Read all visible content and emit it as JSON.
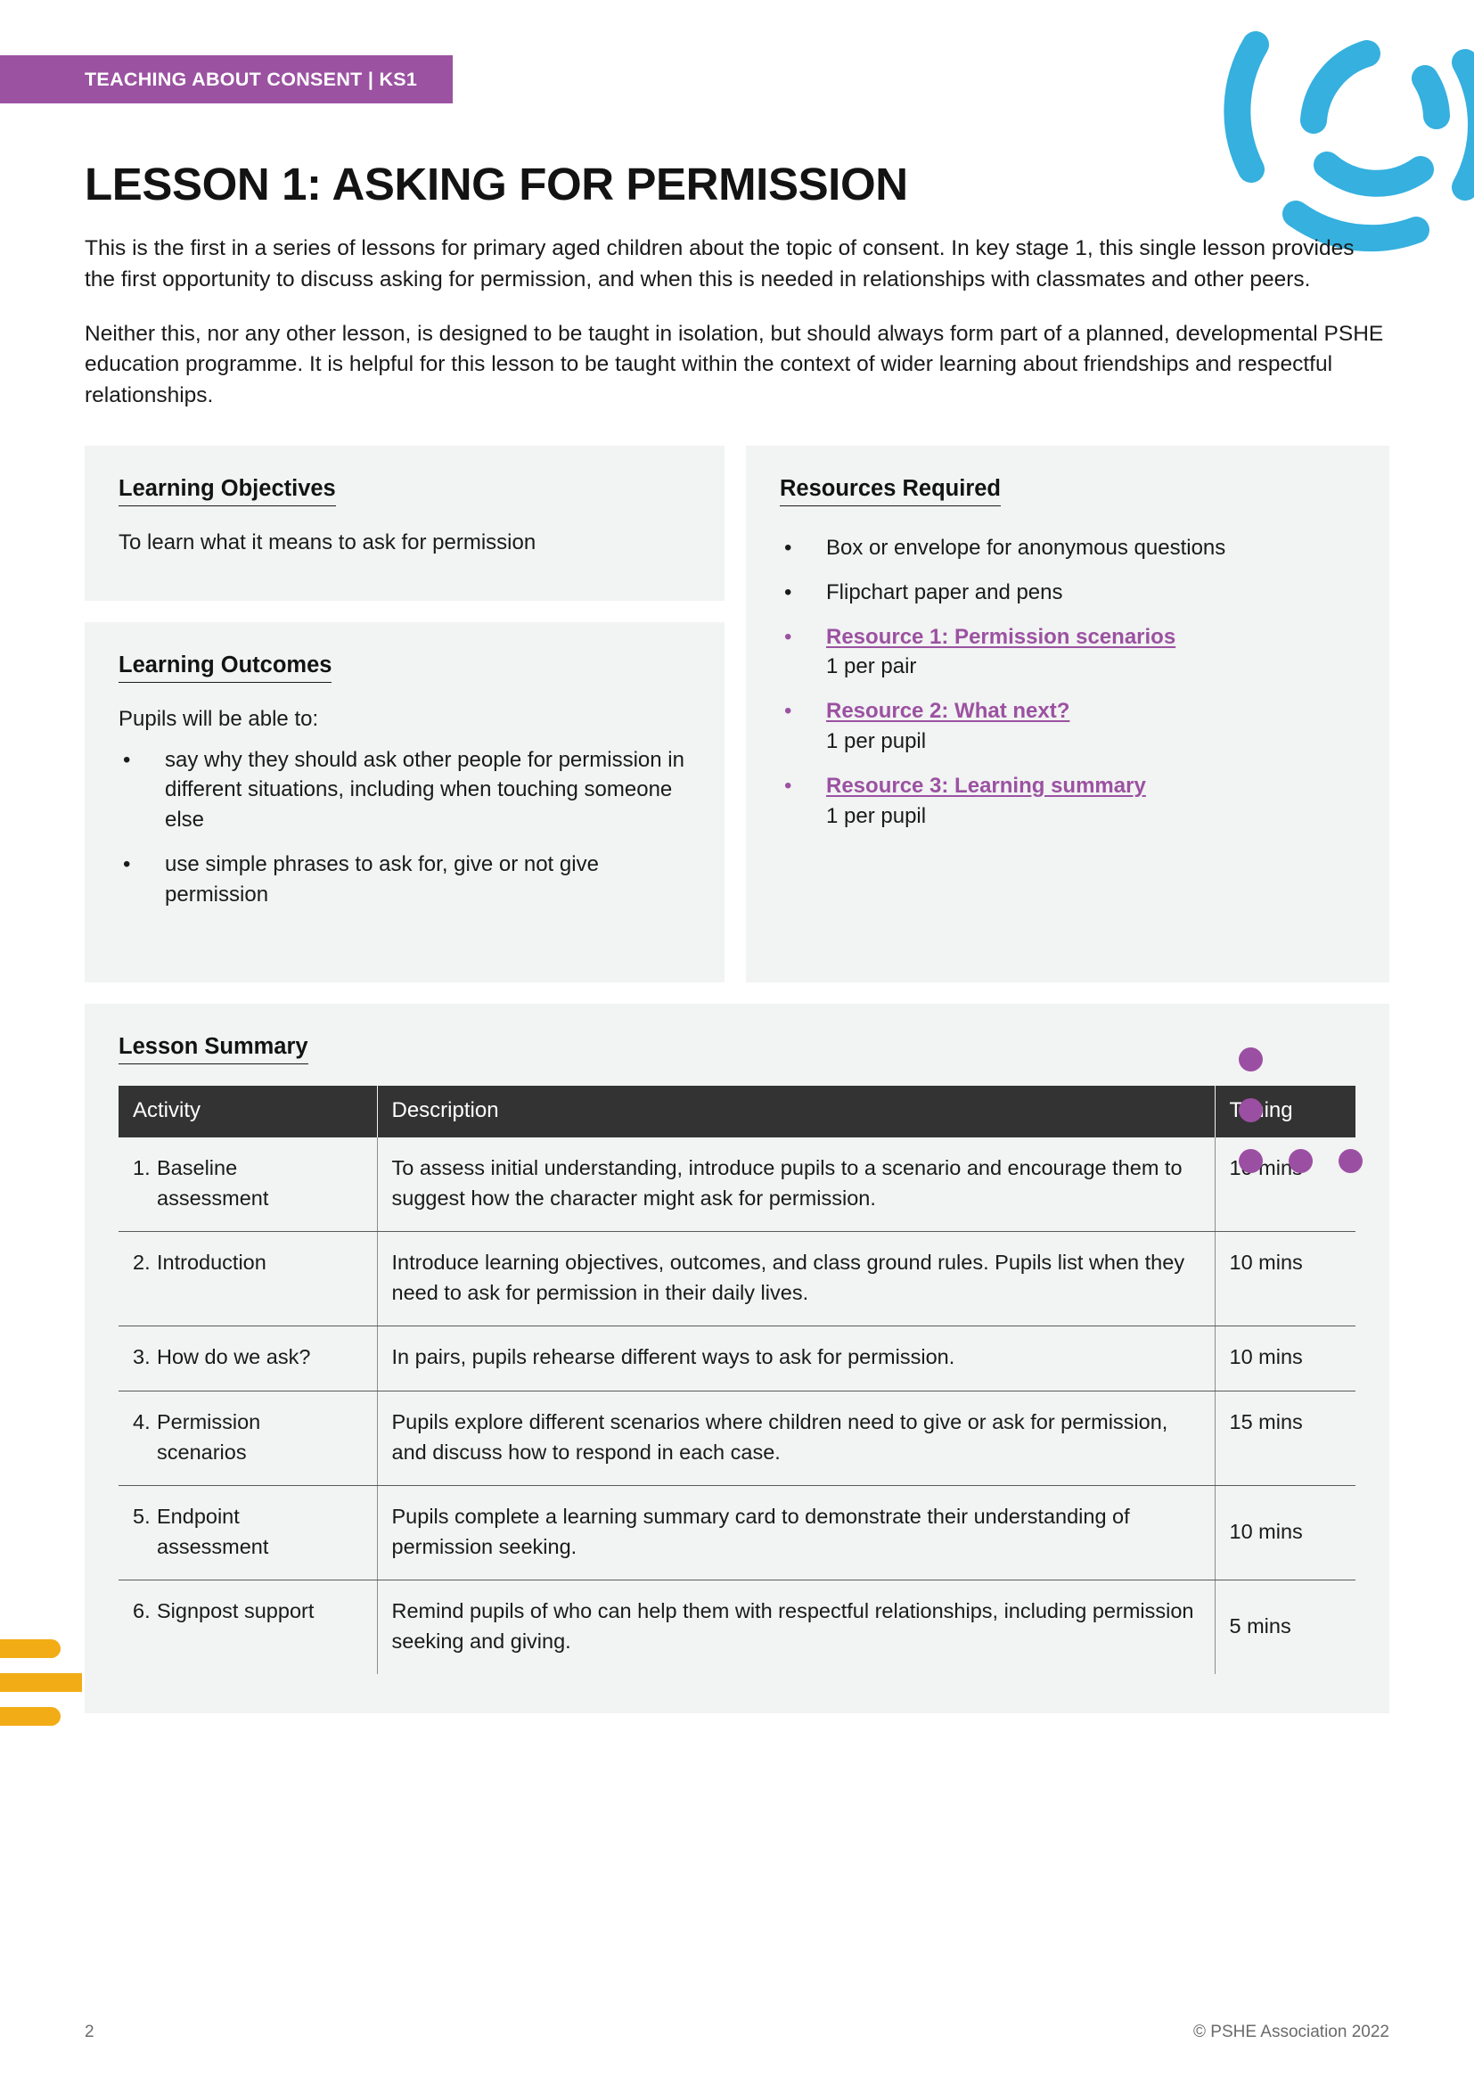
{
  "banner": {
    "label": "TEACHING ABOUT CONSENT | KS1",
    "bg_color": "#9B52A1"
  },
  "title": "LESSON 1: ASKING FOR PERMISSION",
  "intro": {
    "paragraph_1": "This is the first in a series of lessons for primary aged children about the topic of consent. In key stage 1, this single lesson provides the first opportunity to discuss asking for permission, and when this is needed in relationships with classmates and other peers.",
    "paragraph_2": "Neither this, nor any other lesson, is designed to be taught in isolation, but should always form part of a planned, developmental PSHE education programme. It is helpful for this lesson to be taught within the context of wider learning about friendships and respectful relationships."
  },
  "learning_objectives": {
    "heading": "Learning Objectives",
    "text": "To learn what it means to ask for permission"
  },
  "learning_outcomes": {
    "heading": "Learning Outcomes",
    "lead": "Pupils will be able to:",
    "bullets": [
      "say why they should ask other people for permission in different situations, including when touching someone else",
      "use simple phrases to ask for, give or not give permission"
    ]
  },
  "resources": {
    "heading": "Resources Required",
    "items": [
      {
        "text": "Box or envelope for anonymous questions",
        "link": false,
        "note": ""
      },
      {
        "text": "Flipchart paper and pens",
        "link": false,
        "note": ""
      },
      {
        "text": "Resource 1: Permission scenarios",
        "link": true,
        "note": "1 per pair"
      },
      {
        "text": "Resource 2: What next?",
        "link": true,
        "note": "1 per pupil"
      },
      {
        "text": "Resource 3: Learning summary ",
        "link": true,
        "note": "1 per pupil"
      }
    ],
    "link_color": "#9B52A1"
  },
  "lesson_summary": {
    "heading": "Lesson Summary",
    "columns": [
      "Activity",
      "Description",
      "Timing"
    ],
    "rows": [
      {
        "num": "1.",
        "activity": "Baseline assessment",
        "description": "To assess initial understanding, introduce pupils to a scenario and encourage them to suggest how the character might ask for permission.",
        "timing": "10 mins"
      },
      {
        "num": "2.",
        "activity": "Introduction",
        "description": "Introduce learning objectives, outcomes, and class ground rules. Pupils list when they need to ask for permission in their daily lives.",
        "timing": "10 mins"
      },
      {
        "num": "3.",
        "activity": "How do we ask?",
        "description": "In pairs, pupils rehearse different ways to ask for permission.",
        "timing": "10 mins"
      },
      {
        "num": "4.",
        "activity": "Permission scenarios",
        "description": "Pupils explore different scenarios where children need to give or ask for permission, and discuss how to respond in each case.",
        "timing": "15 mins"
      },
      {
        "num": "5.",
        "activity": "Endpoint assessment",
        "description": "Pupils complete a learning summary card to demonstrate their understanding of permission seeking.",
        "timing": "10 mins"
      },
      {
        "num": "6.",
        "activity": "Signpost support",
        "description": "Remind pupils of who can help them with respectful relationships, including permission seeking and giving.",
        "timing": "5 mins"
      }
    ],
    "header_bg": "#333333"
  },
  "footer": {
    "page_number": "2",
    "copyright": "© PSHE Association 2022"
  },
  "decor": {
    "arc_color": "#35B0DF",
    "dot_color": "#9B4FA3",
    "bar_color": "#F2AC16",
    "panel_bg": "#F2F3F3"
  }
}
